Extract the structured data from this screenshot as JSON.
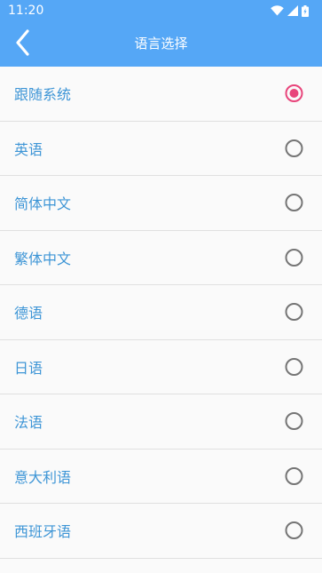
{
  "status_bar": {
    "time": "11:20",
    "icons": [
      "wifi-icon",
      "cell-signal-icon",
      "battery-icon"
    ]
  },
  "header": {
    "title": "语言选择",
    "back_icon": "back-arrow-icon"
  },
  "colors": {
    "header_bg": "#55a7f6",
    "label_text": "#3d95d6",
    "radio_selected": "#e8457b",
    "radio_unselected": "#757575",
    "divider": "#e0e0e0",
    "background": "#fafafa"
  },
  "languages": [
    {
      "label": "跟随系统",
      "selected": true
    },
    {
      "label": "英语",
      "selected": false
    },
    {
      "label": "简体中文",
      "selected": false
    },
    {
      "label": "繁体中文",
      "selected": false
    },
    {
      "label": "德语",
      "selected": false
    },
    {
      "label": "日语",
      "selected": false
    },
    {
      "label": "法语",
      "selected": false
    },
    {
      "label": "意大利语",
      "selected": false
    },
    {
      "label": "西班牙语",
      "selected": false
    }
  ]
}
